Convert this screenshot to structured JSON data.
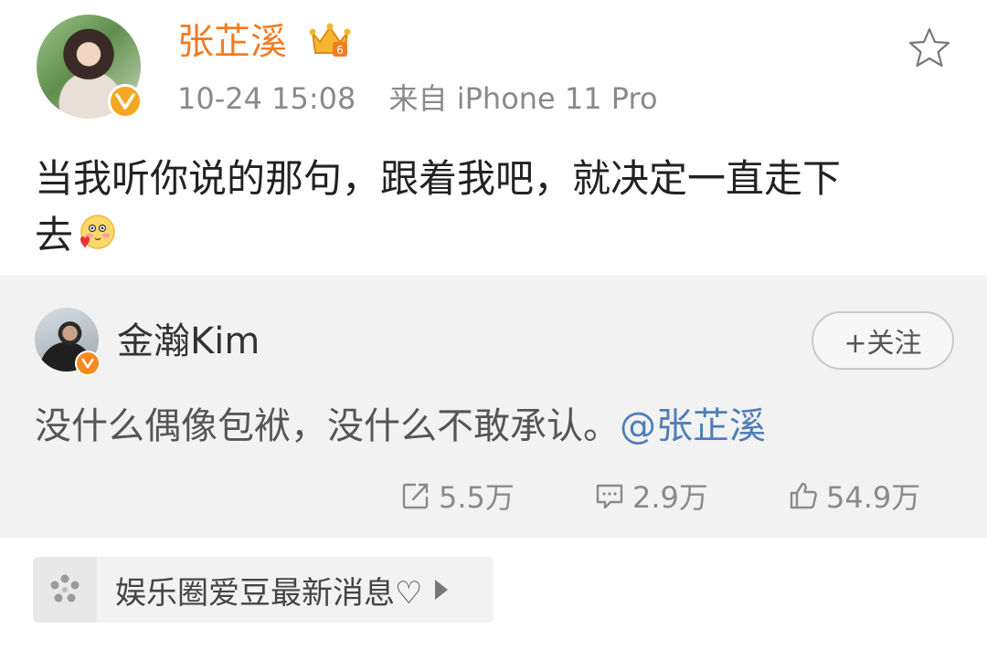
{
  "post": {
    "username": "张芷溪",
    "timestamp": "10-24 15:08",
    "source": "来自 iPhone 11 Pro",
    "content_line1": "当我听你说的那句，跟着我吧，就决定一直走下",
    "content_line2": "去",
    "badge_icon": "verified-v-icon",
    "crown_icon": "member-crown-icon",
    "favorite_icon": "star-icon",
    "emoji_icon": "blush-love-emoji",
    "accent_color": "#f07c24"
  },
  "repost": {
    "username": "金瀚Kim",
    "follow_label": "+关注",
    "text": "没什么偶像包袱，没什么不敢承认。",
    "mention": "@张芷溪",
    "actions": {
      "repost_count": "5.5万",
      "comment_count": "2.9万",
      "like_count": "54.9万"
    },
    "mention_color": "#4f7eb8"
  },
  "topic": {
    "label": "娱乐圈爱豆最新消息♡",
    "icon": "topic-flower-icon"
  }
}
